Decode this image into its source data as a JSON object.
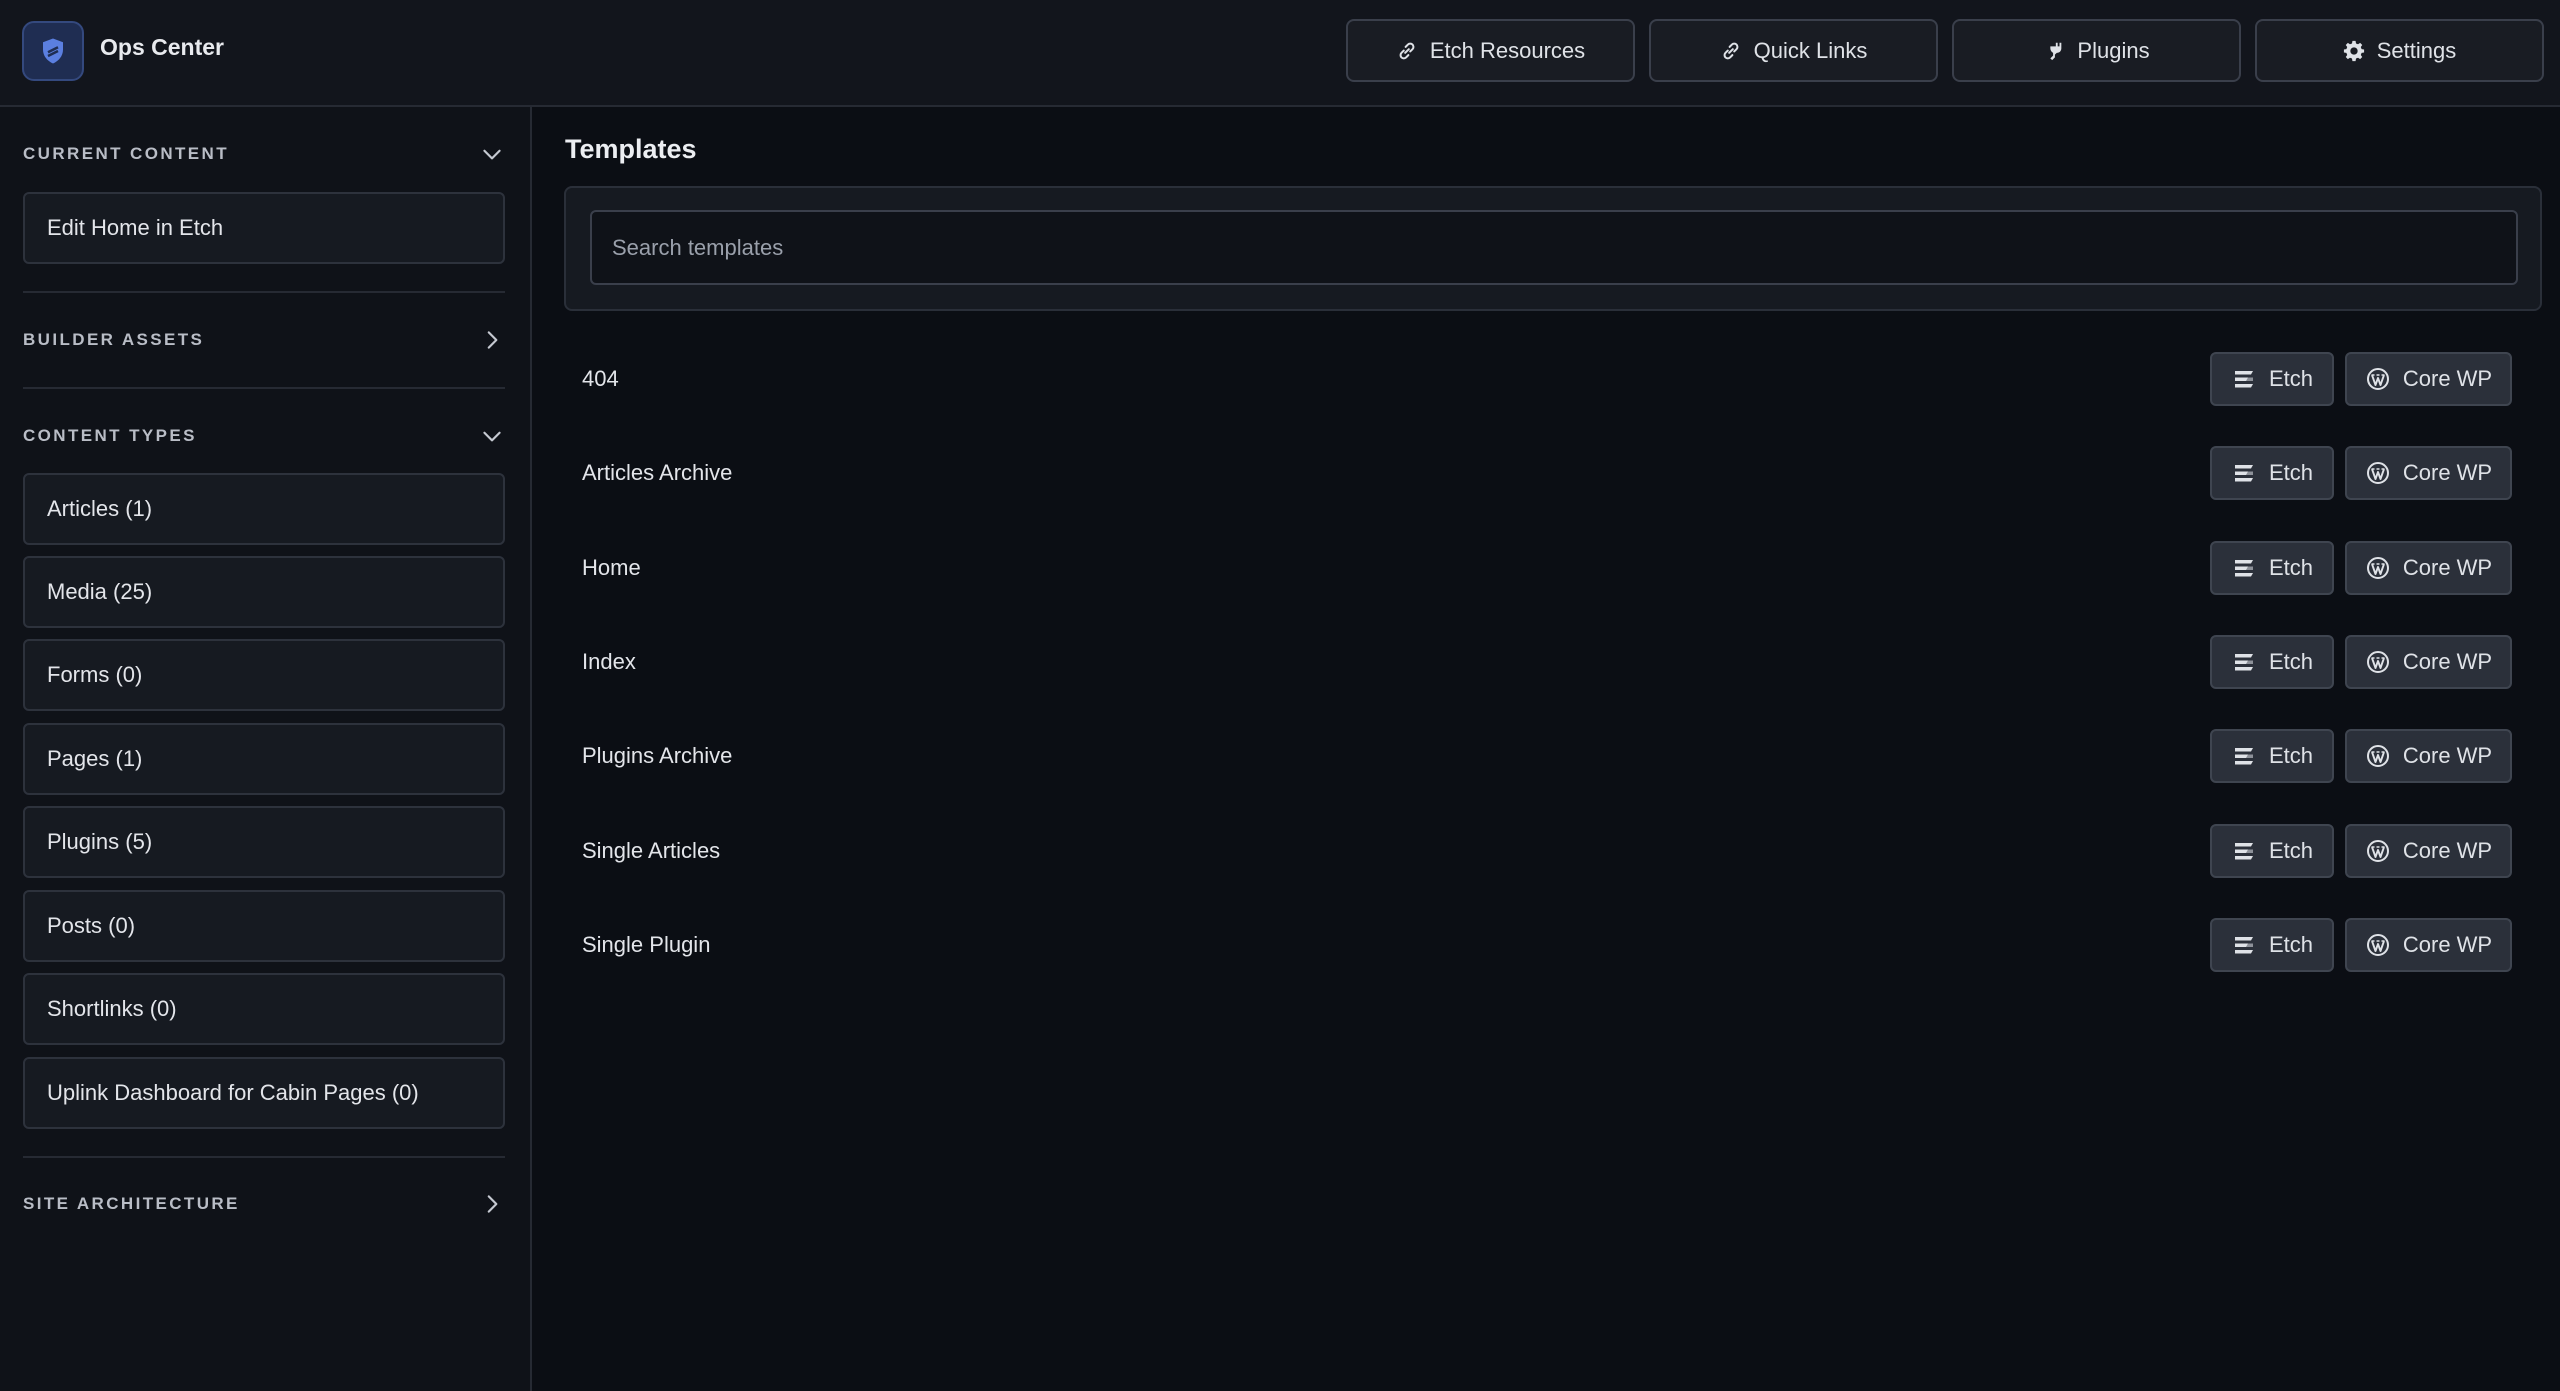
{
  "app": {
    "title": "Ops Center"
  },
  "header": {
    "nav": [
      {
        "label": "Etch Resources",
        "icon": "link-icon"
      },
      {
        "label": "Quick Links",
        "icon": "link-icon"
      },
      {
        "label": "Plugins",
        "icon": "plug-icon"
      },
      {
        "label": "Settings",
        "icon": "gear-icon"
      }
    ]
  },
  "sidebar": {
    "current_content": {
      "title": "CURRENT CONTENT",
      "state": "expanded",
      "item": "Edit Home in Etch"
    },
    "builder_assets": {
      "title": "BUILDER ASSETS",
      "state": "collapsed"
    },
    "content_types": {
      "title": "CONTENT TYPES",
      "state": "expanded",
      "items": [
        "Articles (1)",
        "Media (25)",
        "Forms (0)",
        "Pages (1)",
        "Plugins (5)",
        "Posts (0)",
        "Shortlinks (0)",
        "Uplink Dashboard for Cabin Pages (0)"
      ]
    },
    "site_architecture": {
      "title": "SITE ARCHITECTURE",
      "state": "collapsed"
    }
  },
  "main": {
    "title": "Templates",
    "search": {
      "placeholder": "Search templates",
      "value": ""
    },
    "actions": {
      "etch": "Etch",
      "corewp": "Core WP"
    },
    "templates": [
      "404",
      "Articles Archive",
      "Home",
      "Index",
      "Plugins Archive",
      "Single Articles",
      "Single Plugin"
    ]
  },
  "colors": {
    "background": "#0b0e14",
    "panel": "#161a21",
    "border": "#2d323c",
    "button": "#2b303a",
    "logo_accent": "#5b7fe0"
  }
}
